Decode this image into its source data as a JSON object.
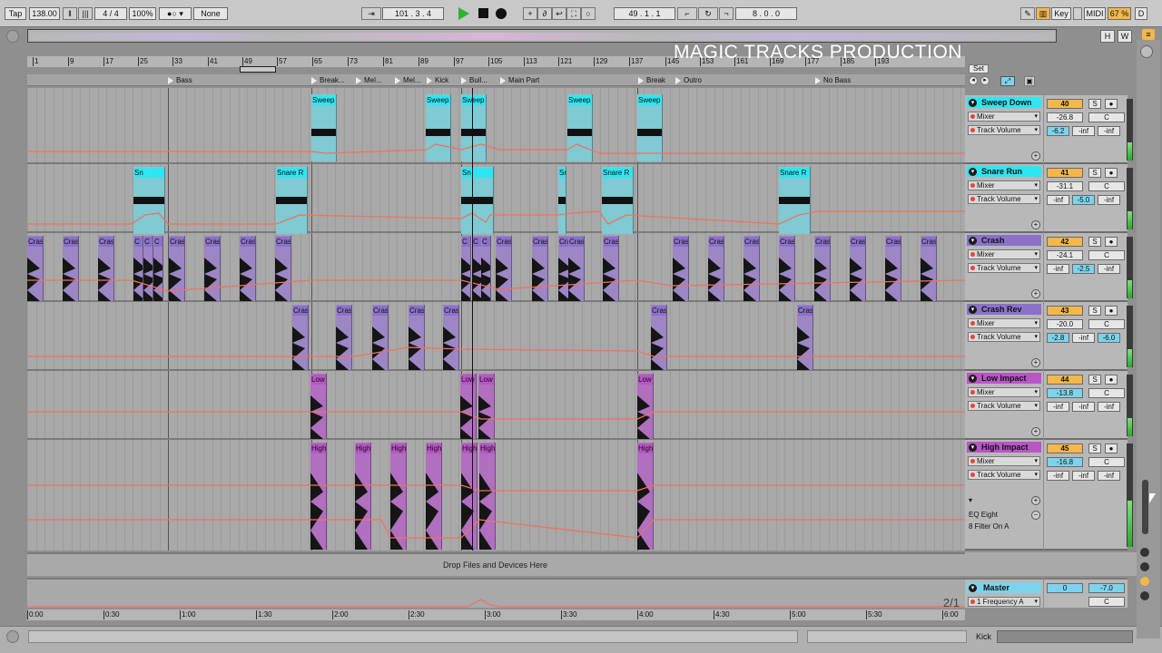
{
  "toolbar": {
    "tap": "Tap",
    "tempo": "138.00",
    "sig": "4 / 4",
    "zoom": "100%",
    "quant": "None",
    "pos1": "101 .   3 .   4",
    "pos2": "49 .   1 .   1",
    "pos3": "8 .   0 .   0",
    "key": "Key",
    "midi": "MIDI",
    "cpu": "67 %",
    "d": "D"
  },
  "overview": {
    "h": "H",
    "w": "W"
  },
  "watermark": "MAGIC TRACKS PRODUCTION",
  "ruler": {
    "bars": [
      "1",
      "9",
      "17",
      "25",
      "33",
      "41",
      "49",
      "57",
      "65",
      "73",
      "81",
      "89",
      "97",
      "105",
      "113",
      "121",
      "129",
      "137",
      "145",
      "153",
      "161",
      "169",
      "177",
      "185",
      "193"
    ]
  },
  "locators": [
    "Bass",
    "Break...",
    "Mel...",
    "Mel...",
    "Kick",
    "Buil...",
    "Main Part",
    "Break",
    "Outro",
    "No Bass"
  ],
  "set_label": "Set",
  "tracks": [
    {
      "name": "Sweep Down",
      "num": "40",
      "device": "Mixer",
      "param": "Track Volume",
      "vol": "-26.8",
      "pan": "C",
      "v1": "-6.2",
      "v2": "-inf",
      "v3": "-inf",
      "color": "#2ee6f2"
    },
    {
      "name": "Snare Run",
      "num": "41",
      "device": "Mixer",
      "param": "Track Volume",
      "vol": "-31.1",
      "pan": "C",
      "v1": "-inf",
      "v2": "-5.0",
      "v3": "-inf",
      "color": "#2ee6f2"
    },
    {
      "name": "Crash",
      "num": "42",
      "device": "Mixer",
      "param": "Track Volume",
      "vol": "-24.1",
      "pan": "C",
      "v1": "-inf",
      "v2": "-2.5",
      "v3": "-inf",
      "color": "#8a72c9"
    },
    {
      "name": "Crash Rev",
      "num": "43",
      "device": "Mixer",
      "param": "Track Volume",
      "vol": "-20.0",
      "pan": "C",
      "v1": "-2.8",
      "v2": "-inf",
      "v3": "-6.0",
      "color": "#8a72c9"
    },
    {
      "name": "Low Impact",
      "num": "44",
      "device": "Mixer",
      "param": "Track Volume",
      "vol": "-13.8",
      "pan": "C",
      "v1": "-inf",
      "v2": "-inf",
      "v3": "-inf",
      "color": "#b856c6"
    },
    {
      "name": "High Impact",
      "num": "45",
      "device": "Mixer",
      "param": "Track Volume",
      "vol": "-16.8",
      "pan": "C",
      "v1": "-inf",
      "v2": "-inf",
      "v3": "-inf",
      "color": "#b856c6",
      "extra1": "EQ Eight",
      "extra2": "8 Filter On A"
    }
  ],
  "clip_labels": {
    "sweep": "Sweep",
    "snare": "Snare R",
    "snare_short": "Sn",
    "crash": "Cras",
    "crash_short": "C",
    "low": "Low",
    "high": "High"
  },
  "drop_text": "Drop Files and Devices Here",
  "master": {
    "name": "Master",
    "param": "1 Frequency A",
    "vol": "0",
    "pan": "-7.0",
    "c": "C"
  },
  "page_ind": "2/1",
  "time": [
    "0:00",
    "0:30",
    "1:00",
    "1:30",
    "2:00",
    "2:30",
    "3:00",
    "3:30",
    "4:00",
    "4:30",
    "5:00",
    "5:30",
    "6:00"
  ],
  "status": {
    "kick": "Kick"
  },
  "s": "S"
}
